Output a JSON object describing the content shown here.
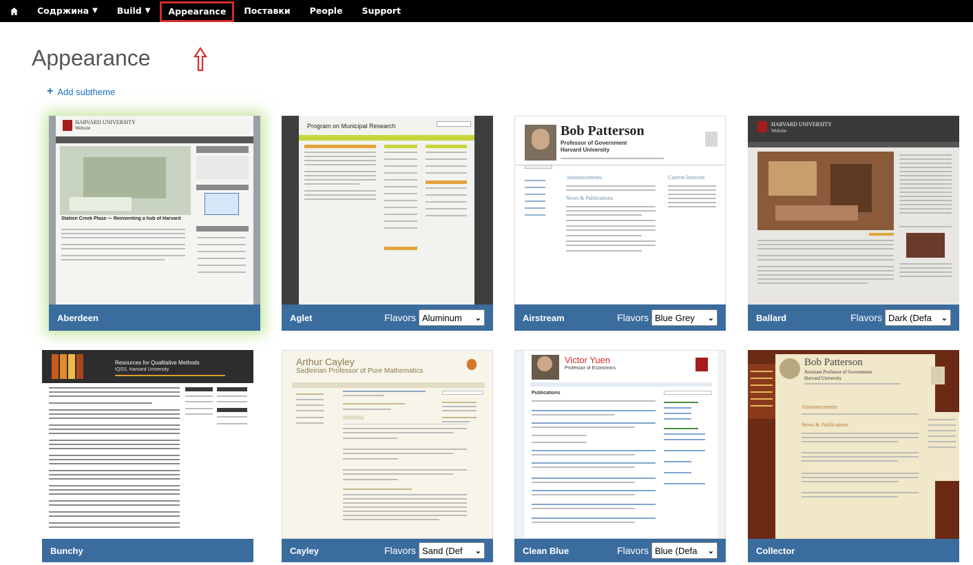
{
  "nav": {
    "home_icon": "home-icon",
    "items": [
      {
        "label": "Содржина",
        "has_caret": true
      },
      {
        "label": "Build",
        "has_caret": true
      },
      {
        "label": "Appearance",
        "active": true
      },
      {
        "label": "Поставки"
      },
      {
        "label": "People"
      },
      {
        "label": "Support"
      }
    ]
  },
  "page": {
    "title": "Appearance",
    "add_subtheme": "Add subtheme"
  },
  "flavors_label": "Flavors",
  "cards": [
    {
      "name": "Aberdeen",
      "flavor": ""
    },
    {
      "name": "Aglet",
      "flavor": "Aluminum"
    },
    {
      "name": "Airstream",
      "flavor": "Blue Grey"
    },
    {
      "name": "Ballard",
      "flavor": "Dark (Defa"
    },
    {
      "name": "Bunchy",
      "flavor": ""
    },
    {
      "name": "Cayley",
      "flavor": "Sand (Def"
    },
    {
      "name": "Clean Blue",
      "flavor": "Blue (Defa"
    },
    {
      "name": "Collector",
      "flavor": ""
    }
  ],
  "previews": {
    "aberdeen": {
      "site": "HARVARD UNIVERSITY",
      "sub": "Website",
      "caption": "Station Creek Plaza — Reinventing a hub of Harvard"
    },
    "aglet": {
      "title": "Program on Municipal Research"
    },
    "airstream": {
      "name": "Bob Patterson",
      "role": "Professor of Government",
      "org": "Harvard University",
      "h1": "Announcements",
      "h2": "News & Publications",
      "h3": "Current Interests"
    },
    "ballard": {
      "site": "HARVARD UNIVERSITY",
      "sub": "Website"
    },
    "bunchy": {
      "title": "Resources for Qualitative Methods",
      "sub": "IQSS, Harvard University"
    },
    "cayley": {
      "name": "Arthur Cayley",
      "role": "Sadleirian Professor of Pure Mathematics"
    },
    "cleanblue": {
      "name": "Victor Yuen",
      "role": "Professor of Economics",
      "section": "Publications"
    },
    "collector": {
      "name": "Bob Patterson",
      "role": "Assistant Professor of Government",
      "org": "Harvard University",
      "h1": "Announcements",
      "h2": "News & Publications"
    }
  },
  "colors": {
    "nav_bg": "#000000",
    "card_bar": "#3a6c9e",
    "active_outline": "#d42d2d",
    "link": "#1a6fbf",
    "selected_glow": "#96d25a"
  }
}
